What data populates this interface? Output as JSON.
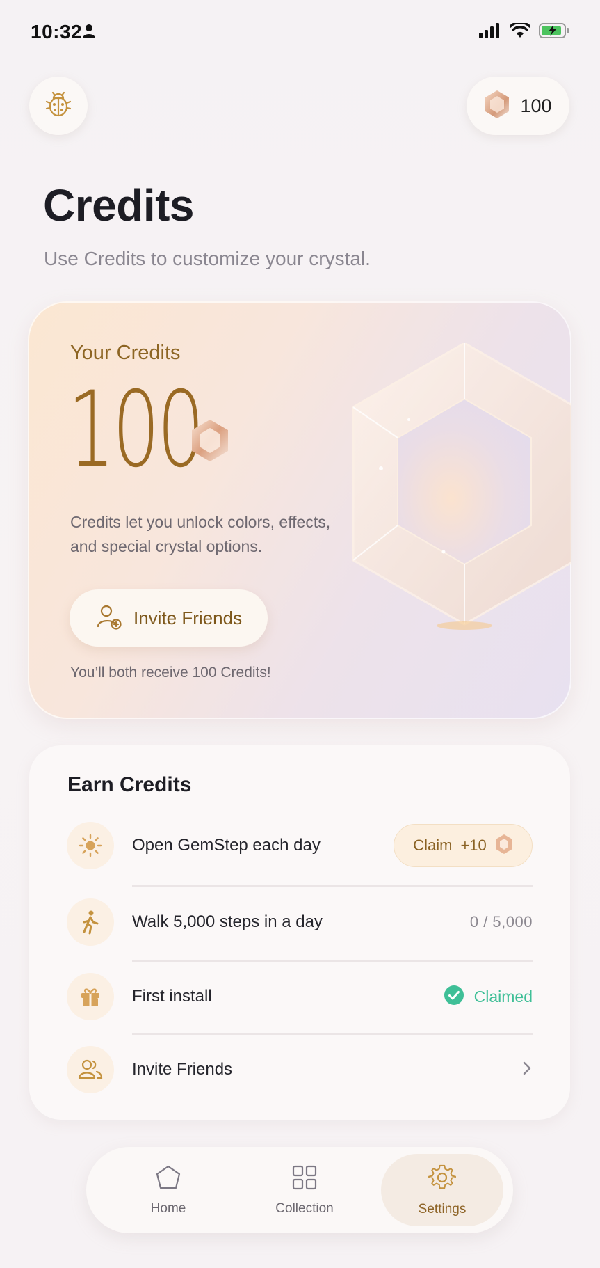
{
  "status_bar": {
    "time": "10:32"
  },
  "header": {
    "balance": "100"
  },
  "page": {
    "title": "Credits",
    "subtitle": "Use Credits to customize your crystal."
  },
  "hero": {
    "label": "Your Credits",
    "value": "100",
    "description": "Credits let you unlock colors, effects, and special crystal options.",
    "invite_label": "Invite Friends",
    "note": "You’ll both receive 100 Credits!"
  },
  "earn": {
    "title": "Earn Credits",
    "items": [
      {
        "label": "Open GemStep each day",
        "icon": "sun-icon",
        "action": "Claim",
        "reward": "+10"
      },
      {
        "label": "Walk 5,000 steps in a day",
        "icon": "walking-icon",
        "progress": "0 / 5,000"
      },
      {
        "label": "First install",
        "icon": "gift-icon",
        "status": "Claimed"
      },
      {
        "label": "Invite Friends",
        "icon": "friends-icon"
      }
    ]
  },
  "nav": {
    "items": [
      {
        "label": "Home",
        "icon": "home-icon"
      },
      {
        "label": "Collection",
        "icon": "grid-icon"
      },
      {
        "label": "Settings",
        "icon": "gear-icon",
        "active": true
      }
    ]
  },
  "colors": {
    "accent": "#9a6a24",
    "success": "#3fbf97",
    "background": "#f6f2f4"
  }
}
